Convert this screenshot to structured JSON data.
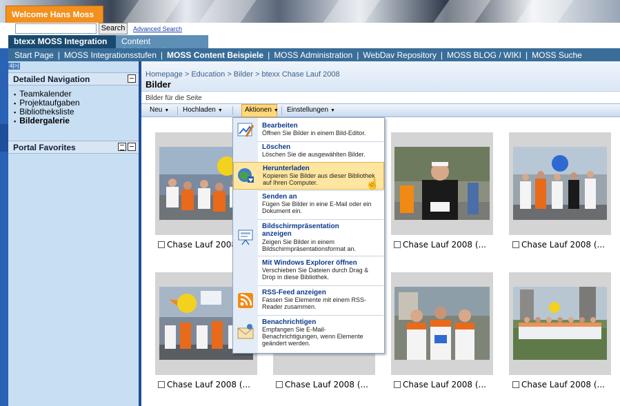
{
  "header": {
    "welcome": "Welcome Hans Moss",
    "search_button": "Search",
    "advanced_search": "Advanced Search",
    "search_value": ""
  },
  "tabs": [
    {
      "label": "btexx MOSS Integration",
      "active": true
    },
    {
      "label": "Content Administration",
      "active": false
    }
  ],
  "global_nav": [
    {
      "label": "Start Page",
      "bold": false
    },
    {
      "label": "MOSS Integrationsstufen",
      "bold": false
    },
    {
      "label": "MOSS Content Beispiele",
      "bold": true
    },
    {
      "label": "MOSS Administration",
      "bold": false
    },
    {
      "label": "WebDav Repository",
      "bold": false
    },
    {
      "label": "MOSS BLOG / WIKI",
      "bold": false
    },
    {
      "label": "MOSS Suche",
      "bold": false
    }
  ],
  "left_nav": {
    "toggles": "4|>|",
    "detailed_navigation": "Detailed Navigation",
    "items": [
      {
        "label": "Teamkalender",
        "selected": false
      },
      {
        "label": "Projektaufgaben",
        "selected": false
      },
      {
        "label": "Bibliotheksliste",
        "selected": false
      },
      {
        "label": "Bildergalerie",
        "selected": true
      }
    ],
    "portal_favorites": "Portal Favorites"
  },
  "main": {
    "breadcrumb": "Homepage > Education > Bilder > btexx Chase Lauf 2008",
    "title": "Bilder",
    "description": "Bilder für die Seite",
    "toolbar": [
      {
        "label": "Neu"
      },
      {
        "label": "Hochladen"
      },
      {
        "label": "Aktionen",
        "active": true
      },
      {
        "label": "Einstellungen"
      }
    ],
    "captions": [
      "Chase Lauf 2008",
      "Chase Lauf 2008 (...",
      "Chase Lauf 2008 (...",
      "Chase Lauf 2008 (...",
      "Chase Lauf 2008 (...",
      "Chase Lauf 2008 (...",
      "Chase Lauf 2008 (..."
    ]
  },
  "menu": [
    {
      "title": "Bearbeiten",
      "sub": "Öffnen Sie Bilder in einem Bild-Editor.",
      "icon": "edit-image-icon"
    },
    {
      "title": "Löschen",
      "sub": "Löschen Sie die ausgewählten Bilder.",
      "icon": "none"
    },
    {
      "title": "Herunterladen",
      "sub": "Kopieren Sie Bilder aus dieser Bibliothek auf Ihren Computer.",
      "icon": "globe-download-icon",
      "hover": true
    },
    {
      "title": "Senden an",
      "sub": "Fügen Sie Bilder in eine E-Mail oder ein Dokument ein.",
      "icon": "none"
    },
    {
      "title": "Bildschirmpräsentation anzeigen",
      "sub": "Zeigen Sie Bilder in einem Bildschirmpräsentationsformat an.",
      "icon": "presentation-icon"
    },
    {
      "title": "Mit Windows Explorer öffnen",
      "sub": "Verschieben Sie Dateien durch Drag & Drop in diese Bibliothek.",
      "icon": "none"
    },
    {
      "title": "RSS-Feed anzeigen",
      "sub": "Fassen Sie Elemente mit einem RSS-Reader zusammen.",
      "icon": "rss-icon"
    },
    {
      "title": "Benachrichtigen",
      "sub": "Empfangen Sie E-Mail-Benachrichtigungen, wenn Elemente geändert werden.",
      "icon": "mail-alert-icon"
    }
  ],
  "colors": {
    "welcome_orange": "#f3901e",
    "tab_active": "#19496e",
    "global_nav": "#3a6e99",
    "left_nav_bg": "#c8def3",
    "menu_hover": "#ffe6a0",
    "menu_title": "#0b3a8c"
  }
}
